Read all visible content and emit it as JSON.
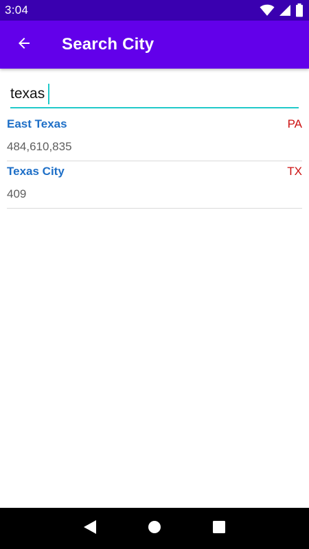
{
  "status_bar": {
    "time": "3:04",
    "icons": [
      "wifi-icon",
      "cell-signal-icon",
      "battery-icon"
    ]
  },
  "app_bar": {
    "title": "Search City",
    "back_icon": "arrow-back-icon",
    "background": "#6200ea"
  },
  "search": {
    "value": "texas",
    "accent": "#1fc9c9"
  },
  "results": [
    {
      "city": "East Texas",
      "state": "PA",
      "population": "484,610,835"
    },
    {
      "city": "Texas City",
      "state": "TX",
      "population": "409"
    }
  ],
  "colors": {
    "status_bar": "#3a00b0",
    "city_text": "#1e6fc7",
    "state_text": "#cc1111",
    "population_text": "#5e5e5e"
  },
  "nav_bar": {
    "buttons": [
      "nav-back-icon",
      "nav-home-icon",
      "nav-recents-icon"
    ]
  }
}
